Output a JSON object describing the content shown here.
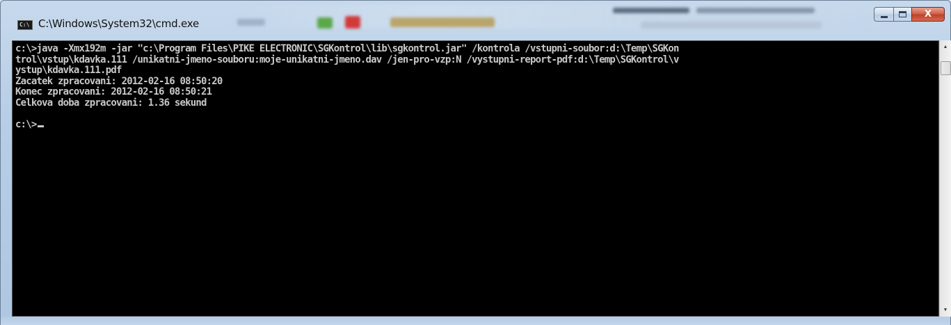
{
  "window": {
    "title": "C:\\Windows\\System32\\cmd.exe",
    "icon": "cmd-app-icon",
    "icon_label": "C:\\",
    "controls": {
      "minimize_icon": "minimize-icon",
      "maximize_icon": "maximize-icon",
      "close_icon": "close-icon",
      "close_glyph": "X"
    }
  },
  "console": {
    "lines": [
      "c:\\>java -Xmx192m -jar \"c:\\Program Files\\PIKE ELECTRONIC\\SGKontrol\\lib\\sgkontrol.jar\" /kontrola /vstupni-soubor:d:\\Temp\\SGKon",
      "trol\\vstup\\kdavka.111 /unikatni-jmeno-souboru:moje-unikatni-jmeno.dav /jen-pro-vzp:N /vystupni-report-pdf:d:\\Temp\\SGKontrol\\v",
      "ystup\\kdavka.111.pdf",
      "Zacatek zpracovani: 2012-02-16 08:50:20",
      "Konec zpracovani: 2012-02-16 08:50:21",
      "Celkova doba zpracovani: 1.36 sekund",
      ""
    ],
    "prompt": "c:\\>",
    "foreground": "#c8c8c8",
    "background": "#000000"
  },
  "scrollbar": {
    "up_arrow": "▲",
    "down_arrow": "▼"
  }
}
